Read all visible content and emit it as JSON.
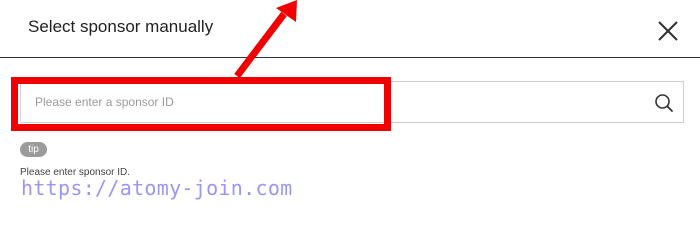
{
  "dialog": {
    "title": "Select sponsor manually",
    "close_icon": "close-icon"
  },
  "search": {
    "placeholder": "Please enter a sponsor ID",
    "value": "",
    "icon": "search-icon"
  },
  "tip": {
    "badge": "tip",
    "text": "Please enter sponsor ID."
  },
  "annotation": {
    "highlight_color": "#f00000",
    "watermark": "https://atomy-join.com"
  },
  "colors": {
    "highlight": "#f00000",
    "watermark": "#9b96f2",
    "badge_bg": "#9b9b9b"
  }
}
